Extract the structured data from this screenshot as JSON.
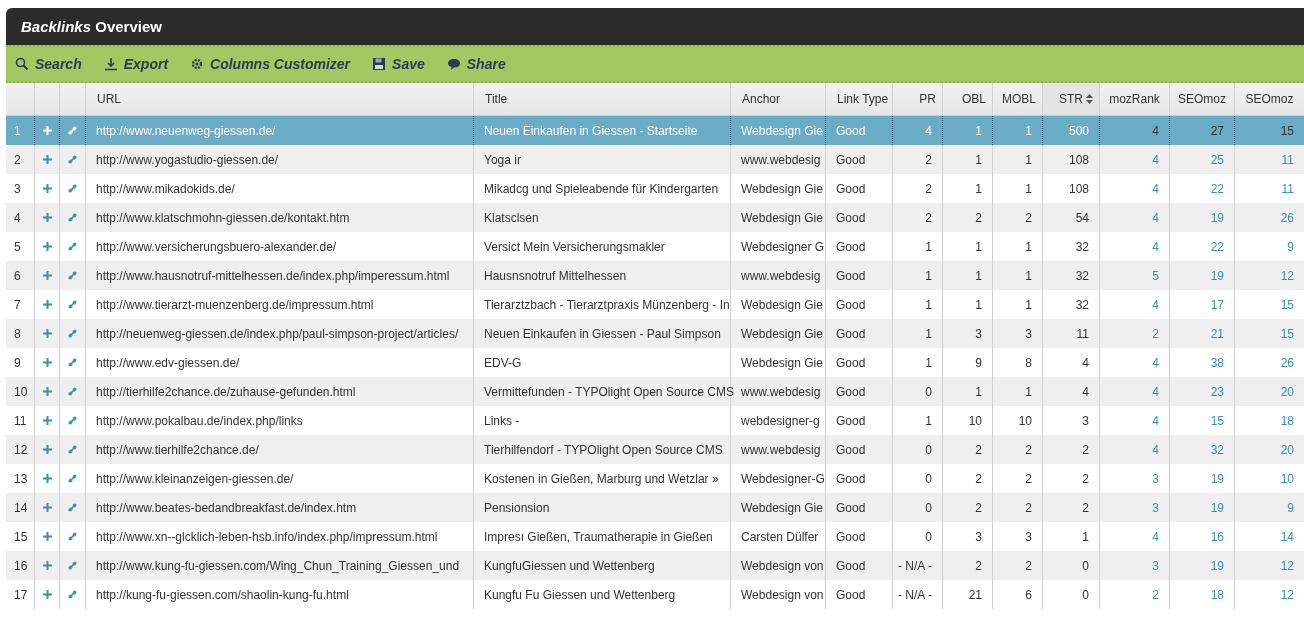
{
  "window": {
    "title": "*Backlinks* Overview"
  },
  "toolbar": [
    {
      "kind": "search",
      "label": "Search"
    },
    {
      "kind": "export",
      "label": "Export"
    },
    {
      "kind": "columns",
      "label": "Columns Customizer"
    },
    {
      "kind": "save",
      "label": "Save"
    },
    {
      "kind": "share",
      "label": "Share"
    }
  ],
  "table": {
    "columns": [
      {
        "label": "URL",
        "kind": "text",
        "sorted": false
      },
      {
        "label": "Title",
        "kind": "text",
        "sorted": false
      },
      {
        "label": "Anchor",
        "kind": "text",
        "sorted": false
      },
      {
        "label": "Link Type",
        "kind": "text",
        "sorted": false
      },
      {
        "label": "PR",
        "kind": "number",
        "sorted": false
      },
      {
        "label": "OBL",
        "kind": "number",
        "sorted": false
      },
      {
        "label": "MOBL",
        "kind": "number",
        "sorted": false
      },
      {
        "label": "STR",
        "kind": "number",
        "sorted": true
      },
      {
        "label": "mozRank",
        "kind": "metric",
        "sorted": false
      },
      {
        "label": "SEOmoz",
        "kind": "metric",
        "sorted": false
      },
      {
        "label": "SEOmoz",
        "kind": "metric",
        "sorted": false
      }
    ],
    "rows": [
      {
        "number": "1",
        "selected": true,
        "cells": [
          "http://www.neuenweg-giessen.de/",
          "Neuen Einkaufen in Giessen - Startseite",
          "Webdesign Gie",
          "Good",
          "4",
          "1",
          "1",
          "500",
          "4",
          "27",
          "15"
        ]
      },
      {
        "number": "2",
        "selected": false,
        "cells": [
          "http://www.yogastudio-giessen.de/",
          "Yoga ir",
          "www.webdesig",
          "Good",
          "2",
          "1",
          "1",
          "108",
          "4",
          "25",
          "11"
        ]
      },
      {
        "number": "3",
        "selected": false,
        "cells": [
          "http://www.mikadokids.de/",
          "Mikadcg und Spieleabende für Kindergarten",
          "Webdesign Gie",
          "Good",
          "2",
          "1",
          "1",
          "108",
          "4",
          "22",
          "11"
        ]
      },
      {
        "number": "4",
        "selected": false,
        "cells": [
          "http://www.klatschmohn-giessen.de/kontakt.htm",
          "Klatsclsen",
          "Webdesign Gie",
          "Good",
          "2",
          "2",
          "2",
          "54",
          "4",
          "19",
          "26"
        ]
      },
      {
        "number": "5",
        "selected": false,
        "cells": [
          "http://www.versicherungsbuero-alexander.de/",
          "Versict Mein Versicherungsmakler",
          "Webdesigner G",
          "Good",
          "1",
          "1",
          "1",
          "32",
          "4",
          "22",
          "9"
        ]
      },
      {
        "number": "6",
        "selected": false,
        "cells": [
          "http://www.hausnotruf-mittelhessen.de/index.php/imperessum.html",
          "Hausnsnotruf Mittelhessen",
          "www.webdesig",
          "Good",
          "1",
          "1",
          "1",
          "32",
          "5",
          "19",
          "12"
        ]
      },
      {
        "number": "7",
        "selected": false,
        "cells": [
          "http://www.tierarzt-muenzenberg.de/impressum.html",
          "Tierarztzbach - Tierarztpraxis Münzenberg - In",
          "Webdesign Gie",
          "Good",
          "1",
          "1",
          "1",
          "32",
          "4",
          "17",
          "15"
        ]
      },
      {
        "number": "8",
        "selected": false,
        "cells": [
          "http://neuenweg-giessen.de/index.php/paul-simpson-project/articles/",
          "Neuen Einkaufen in Giessen - Paul Simpson",
          "Webdesign Gie",
          "Good",
          "1",
          "3",
          "3",
          "11",
          "2",
          "21",
          "15"
        ]
      },
      {
        "number": "9",
        "selected": false,
        "cells": [
          "http://www.edv-giessen.de/",
          "EDV-G",
          "Webdesign Gie",
          "Good",
          "1",
          "9",
          "8",
          "4",
          "4",
          "38",
          "26"
        ]
      },
      {
        "number": "10",
        "selected": false,
        "cells": [
          "http://tierhilfe2chance.de/zuhause-gefunden.html",
          "Vermittefunden - TYPOlight Open Source CMS",
          "www.webdesig",
          "Good",
          "0",
          "1",
          "1",
          "4",
          "4",
          "23",
          "20"
        ]
      },
      {
        "number": "11",
        "selected": false,
        "cells": [
          "http://www.pokalbau.de/index.php/links",
          "Links -",
          "webdesigner-g",
          "Good",
          "1",
          "10",
          "10",
          "3",
          "4",
          "15",
          "18"
        ]
      },
      {
        "number": "12",
        "selected": false,
        "cells": [
          "http://www.tierhilfe2chance.de/",
          "Tierhilfendorf - TYPOlight Open Source CMS",
          "www.webdesig",
          "Good",
          "0",
          "2",
          "2",
          "2",
          "4",
          "32",
          "20"
        ]
      },
      {
        "number": "13",
        "selected": false,
        "cells": [
          "http://www.kleinanzeigen-giessen.de/",
          "Kostenen in Gießen, Marburg und Wetzlar »",
          "Webdesigner-G",
          "Good",
          "0",
          "2",
          "2",
          "2",
          "3",
          "19",
          "10"
        ]
      },
      {
        "number": "14",
        "selected": false,
        "cells": [
          "http://www.beates-bedandbreakfast.de/index.htm",
          "Pensionsion",
          "Webdesign Gie",
          "Good",
          "0",
          "2",
          "2",
          "2",
          "3",
          "19",
          "9"
        ]
      },
      {
        "number": "15",
        "selected": false,
        "cells": [
          "http://www.xn--glcklich-leben-hsb.info/index.php/impressum.html",
          "Impresı Gießen, Traumatherapie in Gießen",
          "Carsten Dülfer",
          "Good",
          "0",
          "3",
          "3",
          "1",
          "4",
          "16",
          "14"
        ]
      },
      {
        "number": "16",
        "selected": false,
        "cells": [
          "http://www.kung-fu-giessen.com/Wing_Chun_Training_Giessen_und",
          "KungfuGiessen und Wettenberg",
          "Webdesign von",
          "Good",
          "- N/A -",
          "2",
          "2",
          "0",
          "3",
          "19",
          "12"
        ]
      },
      {
        "number": "17",
        "selected": false,
        "cells": [
          "http://kung-fu-giessen.com/shaolin-kung-fu.html",
          "Kungfu Fu Giessen und Wettenberg",
          "Webdesign von",
          "Good",
          "- N/A -",
          "21",
          "6",
          "0",
          "2",
          "18",
          "12"
        ]
      }
    ]
  }
}
